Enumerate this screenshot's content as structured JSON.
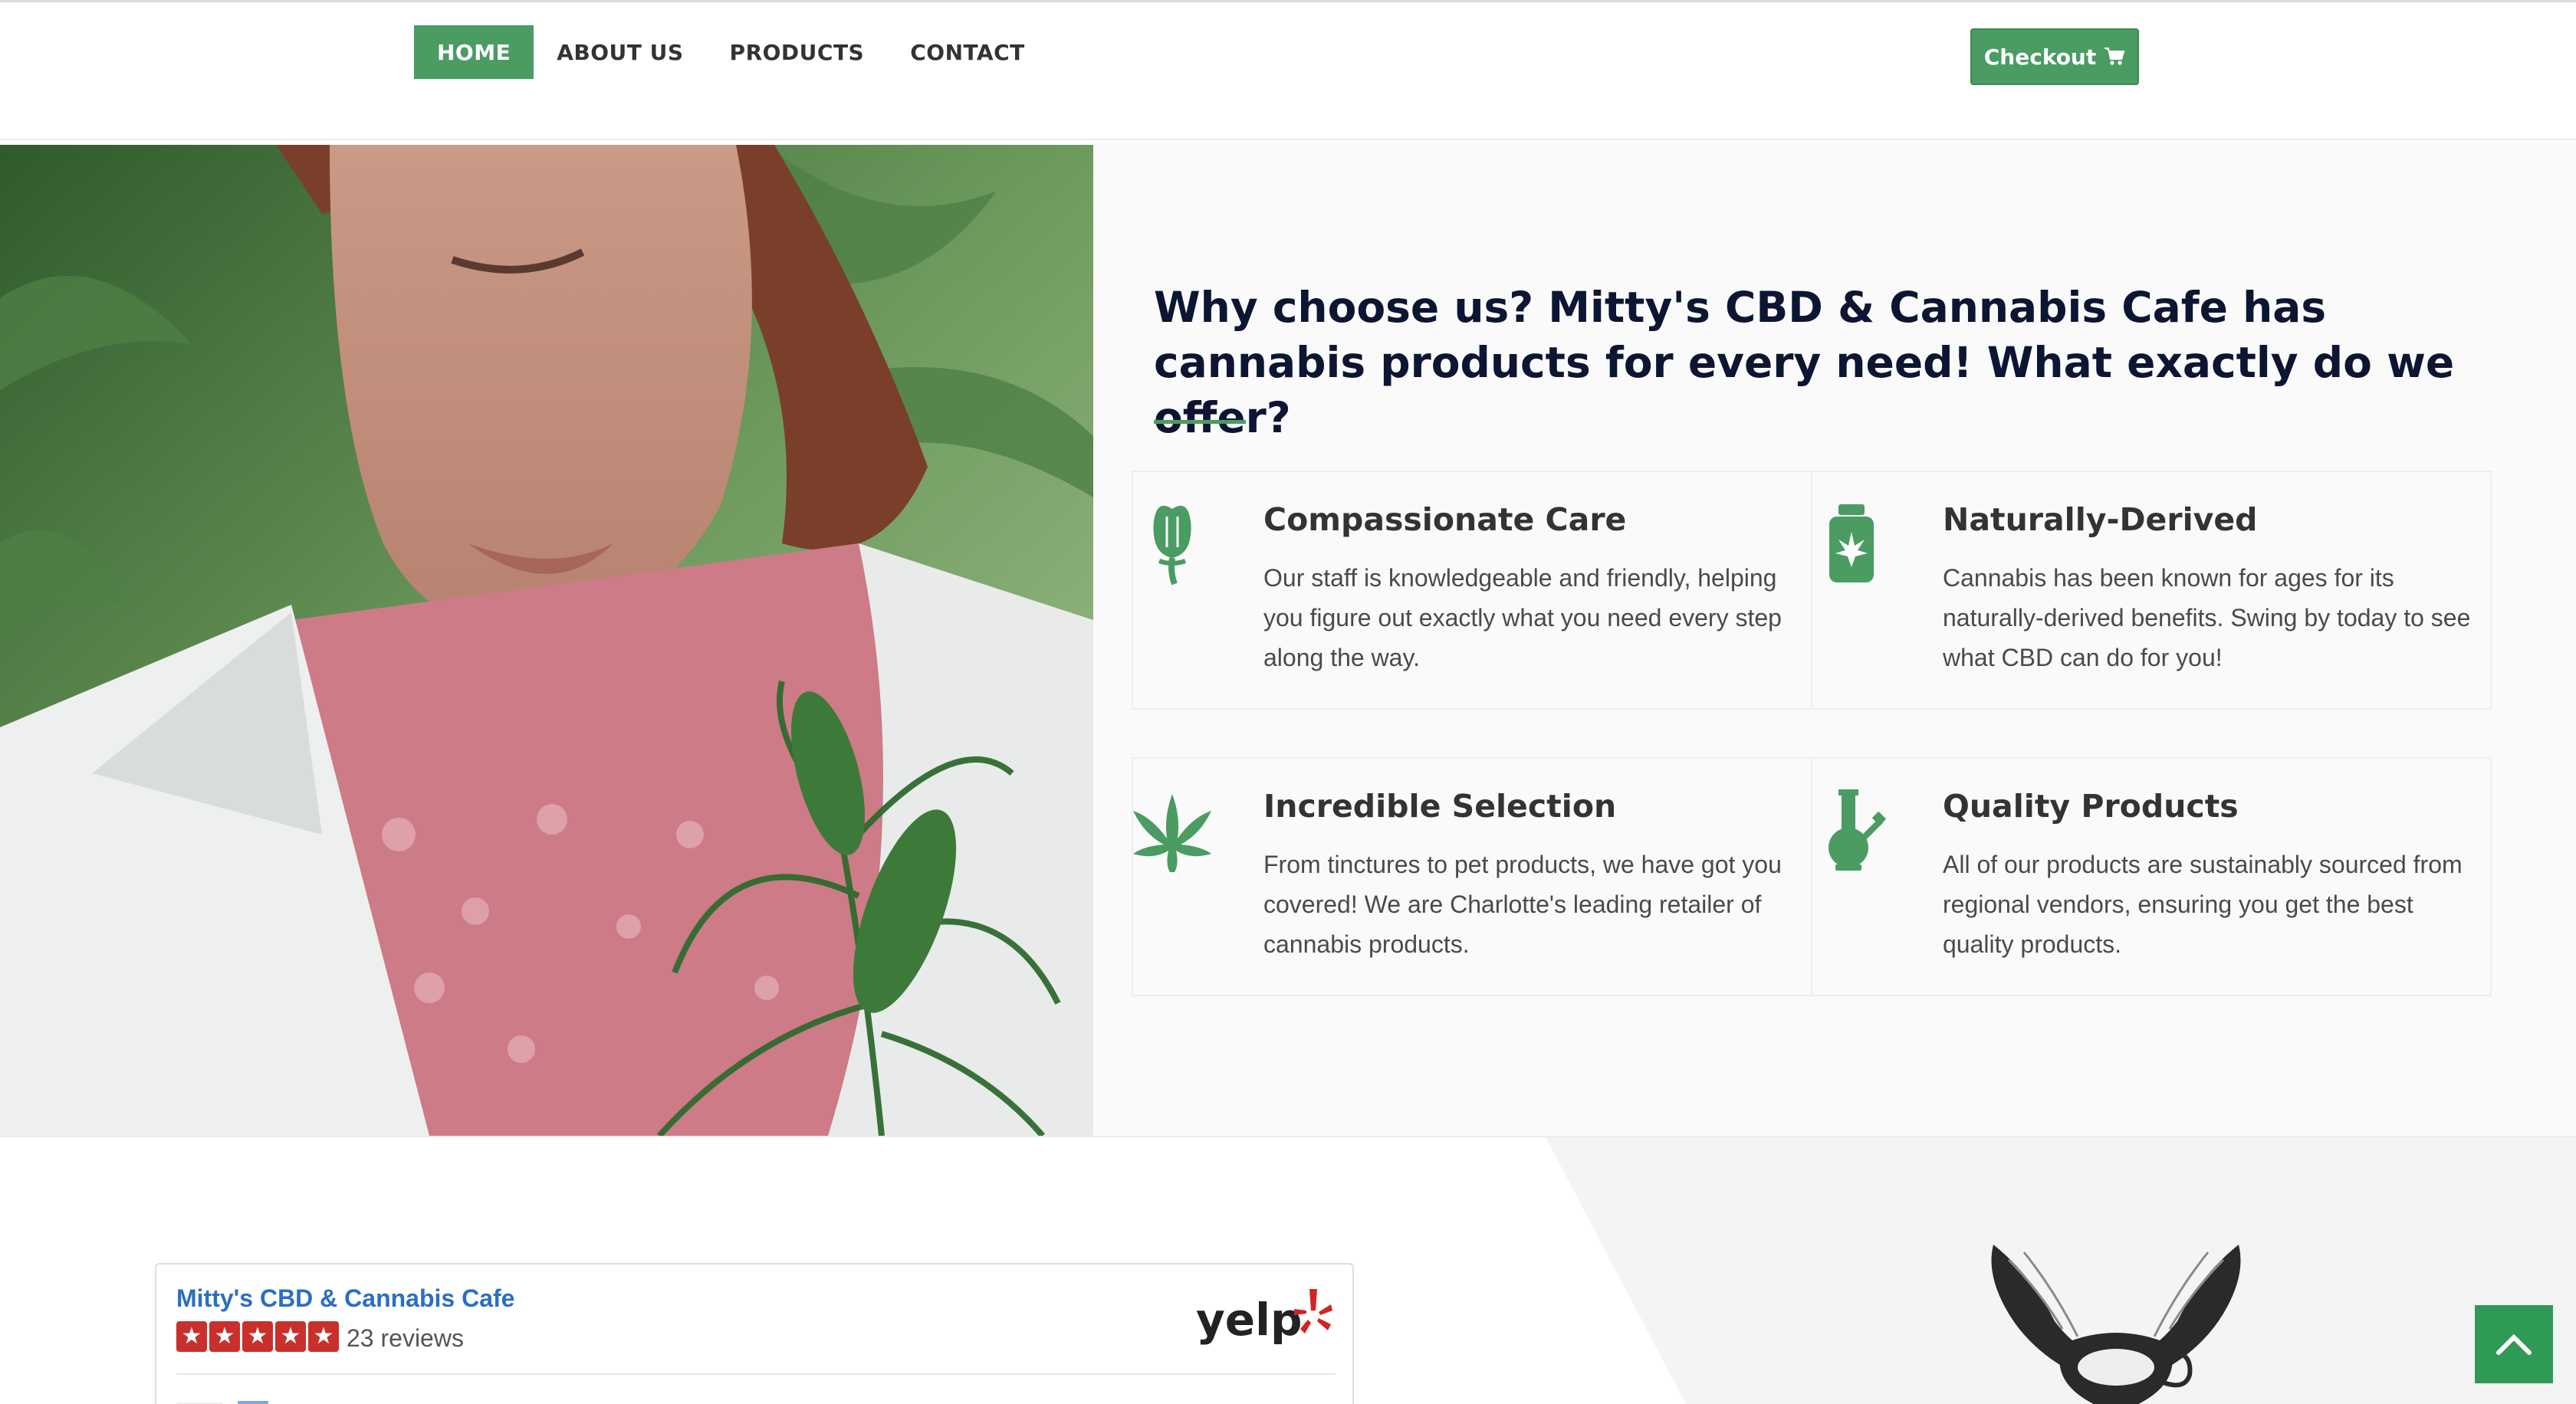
{
  "nav": {
    "items": [
      {
        "label": "HOME",
        "active": true
      },
      {
        "label": "ABOUT US",
        "active": false
      },
      {
        "label": "PRODUCTS",
        "active": false
      },
      {
        "label": "CONTACT",
        "active": false
      }
    ],
    "checkout_label": "Checkout"
  },
  "hero": {
    "title": "Why choose us? Mitty's CBD & Cannabis Cafe has cannabis products for every need! What exactly do we offer?"
  },
  "features": [
    {
      "icon": "poppy-bud-icon",
      "title": "Compassionate Care",
      "description": "Our staff is knowledgeable and friendly, helping you figure out exactly what you need every step along the way."
    },
    {
      "icon": "cannabis-jar-icon",
      "title": "Naturally-Derived",
      "description": "Cannabis has been known for ages for its naturally-derived benefits. Swing by today to see what CBD can do for you!"
    },
    {
      "icon": "cannabis-leaf-icon",
      "title": "Incredible Selection",
      "description": "From tinctures to pet products, we have got you covered! We are Charlotte's leading retailer of cannabis products."
    },
    {
      "icon": "bong-icon",
      "title": "Quality Products",
      "description": "All of our products are sustainably sourced from regional vendors, ensuring you get the best quality products."
    }
  ],
  "yelp": {
    "business_name": "Mitty's CBD & Cannabis Cafe",
    "rating": 5,
    "review_count": "23 reviews",
    "logo_text": "yelp"
  },
  "colors": {
    "brand_green": "#4a9c63",
    "title_navy": "#0c1633",
    "yelp_red": "#c9302c",
    "scroll_top_green": "#2f9a55"
  }
}
